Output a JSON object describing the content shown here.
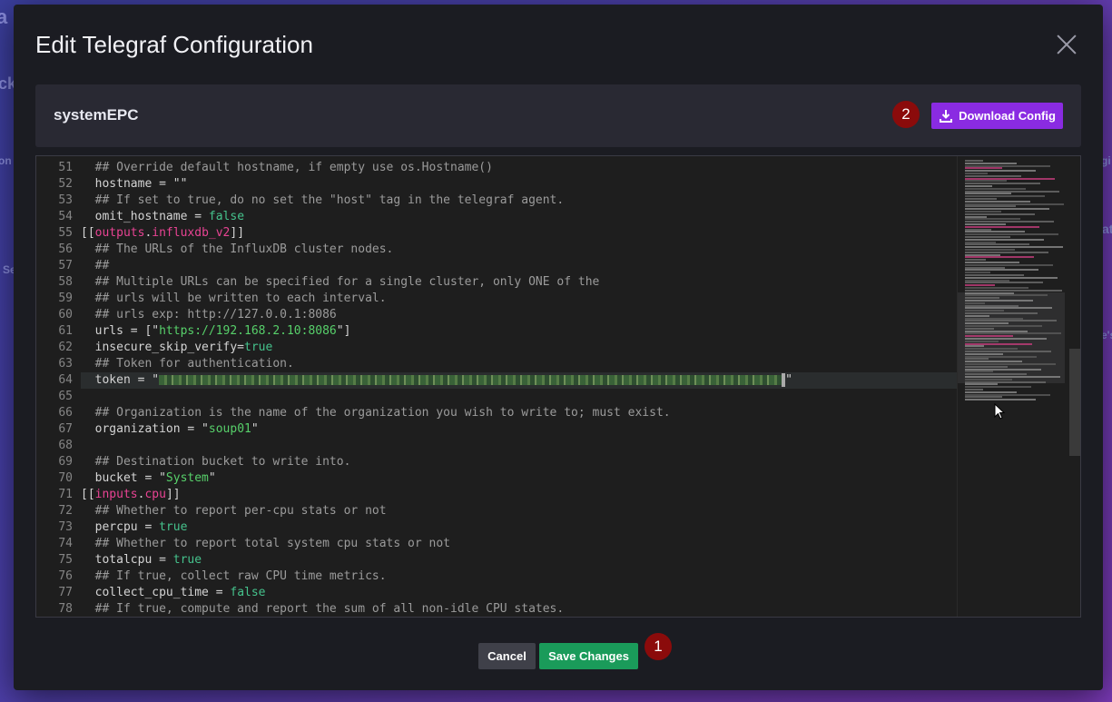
{
  "dialog": {
    "title": "Edit Telegraf Configuration",
    "config_name": "systemEPC",
    "download_label": "Download Config",
    "cancel_label": "Cancel",
    "save_label": "Save Changes",
    "badges": [
      "1",
      "2"
    ]
  },
  "background_peeks": [
    "a",
    "ck",
    "on",
    "gi",
    "Se",
    "at",
    "e's"
  ],
  "editor": {
    "lines": [
      {
        "n": "51",
        "t": "  ## Override default hostname, if empty use os.Hostname()",
        "type": "comment"
      },
      {
        "n": "52",
        "t": "  hostname = \"\"",
        "type": "plain"
      },
      {
        "n": "53",
        "t": "  ## If set to true, do no set the \"host\" tag in the telegraf agent.",
        "type": "comment"
      },
      {
        "n": "54",
        "t": "  omit_hostname = false",
        "type": "kv_bool"
      },
      {
        "n": "55",
        "t": "[[outputs.influxdb_v2]]",
        "type": "section"
      },
      {
        "n": "56",
        "t": "  ## The URLs of the InfluxDB cluster nodes.",
        "type": "comment"
      },
      {
        "n": "57",
        "t": "  ##",
        "type": "comment"
      },
      {
        "n": "58",
        "t": "  ## Multiple URLs can be specified for a single cluster, only ONE of the",
        "type": "comment"
      },
      {
        "n": "59",
        "t": "  ## urls will be written to each interval.",
        "type": "comment"
      },
      {
        "n": "60",
        "t": "  ## urls exp: http://127.0.0.1:8086",
        "type": "comment"
      },
      {
        "n": "61",
        "t": "  urls = [\"https://192.168.2.10:8086\"]",
        "type": "urls"
      },
      {
        "n": "62",
        "t": "  insecure_skip_verify=true",
        "type": "kv_bool"
      },
      {
        "n": "63",
        "t": "  ## Token for authentication.",
        "type": "comment"
      },
      {
        "n": "64",
        "t": "  token = \"",
        "type": "token"
      },
      {
        "n": "65",
        "t": "",
        "type": "plain"
      },
      {
        "n": "66",
        "t": "  ## Organization is the name of the organization you wish to write to; must exist.",
        "type": "comment"
      },
      {
        "n": "67",
        "t": "  organization = \"soup01\"",
        "type": "kv_str"
      },
      {
        "n": "68",
        "t": "",
        "type": "plain"
      },
      {
        "n": "69",
        "t": "  ## Destination bucket to write into.",
        "type": "comment"
      },
      {
        "n": "70",
        "t": "  bucket = \"System\"",
        "type": "kv_str"
      },
      {
        "n": "71",
        "t": "[[inputs.cpu]]",
        "type": "section"
      },
      {
        "n": "72",
        "t": "  ## Whether to report per-cpu stats or not",
        "type": "comment"
      },
      {
        "n": "73",
        "t": "  percpu = true",
        "type": "kv_bool"
      },
      {
        "n": "74",
        "t": "  ## Whether to report total system cpu stats or not",
        "type": "comment"
      },
      {
        "n": "75",
        "t": "  totalcpu = true",
        "type": "kv_bool"
      },
      {
        "n": "76",
        "t": "  ## If true, collect raw CPU time metrics.",
        "type": "comment"
      },
      {
        "n": "77",
        "t": "  collect_cpu_time = false",
        "type": "kv_bool"
      },
      {
        "n": "78",
        "t": "  ## If true, compute and report the sum of all non-idle CPU states.",
        "type": "comment"
      }
    ]
  },
  "colors": {
    "accent": "#8a2be2",
    "save": "#1a9b5a",
    "badge": "#8b0b0b"
  }
}
